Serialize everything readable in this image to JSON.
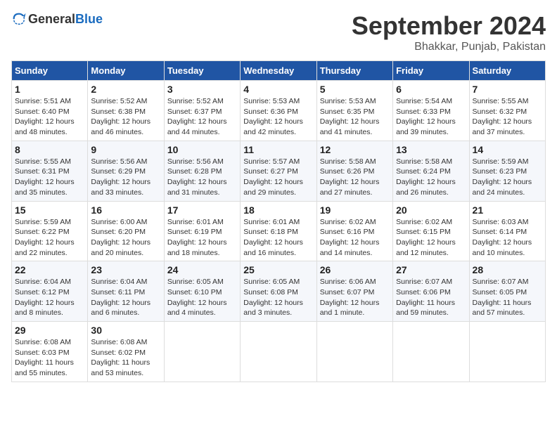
{
  "logo": {
    "text_general": "General",
    "text_blue": "Blue"
  },
  "title": {
    "month": "September 2024",
    "location": "Bhakkar, Punjab, Pakistan"
  },
  "calendar": {
    "headers": [
      "Sunday",
      "Monday",
      "Tuesday",
      "Wednesday",
      "Thursday",
      "Friday",
      "Saturday"
    ],
    "weeks": [
      [
        null,
        {
          "day": "2",
          "sunrise": "5:52 AM",
          "sunset": "6:38 PM",
          "daylight": "12 hours and 46 minutes."
        },
        {
          "day": "3",
          "sunrise": "5:52 AM",
          "sunset": "6:37 PM",
          "daylight": "12 hours and 44 minutes."
        },
        {
          "day": "4",
          "sunrise": "5:53 AM",
          "sunset": "6:36 PM",
          "daylight": "12 hours and 42 minutes."
        },
        {
          "day": "5",
          "sunrise": "5:53 AM",
          "sunset": "6:35 PM",
          "daylight": "12 hours and 41 minutes."
        },
        {
          "day": "6",
          "sunrise": "5:54 AM",
          "sunset": "6:33 PM",
          "daylight": "12 hours and 39 minutes."
        },
        {
          "day": "7",
          "sunrise": "5:55 AM",
          "sunset": "6:32 PM",
          "daylight": "12 hours and 37 minutes."
        }
      ],
      [
        {
          "day": "1",
          "sunrise": "5:51 AM",
          "sunset": "6:40 PM",
          "daylight": "12 hours and 48 minutes."
        },
        {
          "day": "9",
          "sunrise": "5:56 AM",
          "sunset": "6:29 PM",
          "daylight": "12 hours and 33 minutes."
        },
        {
          "day": "10",
          "sunrise": "5:56 AM",
          "sunset": "6:28 PM",
          "daylight": "12 hours and 31 minutes."
        },
        {
          "day": "11",
          "sunrise": "5:57 AM",
          "sunset": "6:27 PM",
          "daylight": "12 hours and 29 minutes."
        },
        {
          "day": "12",
          "sunrise": "5:58 AM",
          "sunset": "6:26 PM",
          "daylight": "12 hours and 27 minutes."
        },
        {
          "day": "13",
          "sunrise": "5:58 AM",
          "sunset": "6:24 PM",
          "daylight": "12 hours and 26 minutes."
        },
        {
          "day": "14",
          "sunrise": "5:59 AM",
          "sunset": "6:23 PM",
          "daylight": "12 hours and 24 minutes."
        }
      ],
      [
        {
          "day": "8",
          "sunrise": "5:55 AM",
          "sunset": "6:31 PM",
          "daylight": "12 hours and 35 minutes."
        },
        {
          "day": "16",
          "sunrise": "6:00 AM",
          "sunset": "6:20 PM",
          "daylight": "12 hours and 20 minutes."
        },
        {
          "day": "17",
          "sunrise": "6:01 AM",
          "sunset": "6:19 PM",
          "daylight": "12 hours and 18 minutes."
        },
        {
          "day": "18",
          "sunrise": "6:01 AM",
          "sunset": "6:18 PM",
          "daylight": "12 hours and 16 minutes."
        },
        {
          "day": "19",
          "sunrise": "6:02 AM",
          "sunset": "6:16 PM",
          "daylight": "12 hours and 14 minutes."
        },
        {
          "day": "20",
          "sunrise": "6:02 AM",
          "sunset": "6:15 PM",
          "daylight": "12 hours and 12 minutes."
        },
        {
          "day": "21",
          "sunrise": "6:03 AM",
          "sunset": "6:14 PM",
          "daylight": "12 hours and 10 minutes."
        }
      ],
      [
        {
          "day": "15",
          "sunrise": "5:59 AM",
          "sunset": "6:22 PM",
          "daylight": "12 hours and 22 minutes."
        },
        {
          "day": "23",
          "sunrise": "6:04 AM",
          "sunset": "6:11 PM",
          "daylight": "12 hours and 6 minutes."
        },
        {
          "day": "24",
          "sunrise": "6:05 AM",
          "sunset": "6:10 PM",
          "daylight": "12 hours and 4 minutes."
        },
        {
          "day": "25",
          "sunrise": "6:05 AM",
          "sunset": "6:08 PM",
          "daylight": "12 hours and 3 minutes."
        },
        {
          "day": "26",
          "sunrise": "6:06 AM",
          "sunset": "6:07 PM",
          "daylight": "12 hours and 1 minute."
        },
        {
          "day": "27",
          "sunrise": "6:07 AM",
          "sunset": "6:06 PM",
          "daylight": "11 hours and 59 minutes."
        },
        {
          "day": "28",
          "sunrise": "6:07 AM",
          "sunset": "6:05 PM",
          "daylight": "11 hours and 57 minutes."
        }
      ],
      [
        {
          "day": "22",
          "sunrise": "6:04 AM",
          "sunset": "6:12 PM",
          "daylight": "12 hours and 8 minutes."
        },
        {
          "day": "30",
          "sunrise": "6:08 AM",
          "sunset": "6:02 PM",
          "daylight": "11 hours and 53 minutes."
        },
        null,
        null,
        null,
        null,
        null
      ],
      [
        {
          "day": "29",
          "sunrise": "6:08 AM",
          "sunset": "6:03 PM",
          "daylight": "11 hours and 55 minutes."
        },
        null,
        null,
        null,
        null,
        null,
        null
      ]
    ]
  }
}
